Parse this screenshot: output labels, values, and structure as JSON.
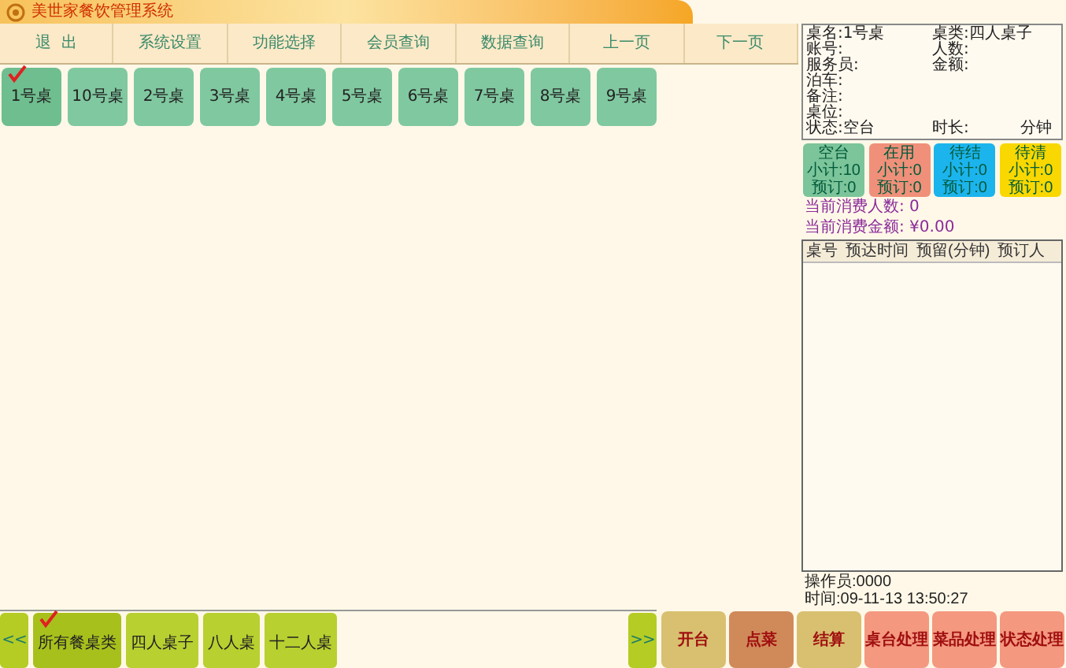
{
  "window": {
    "title": "美世家餐饮管理系统"
  },
  "menu": [
    {
      "label": "退  出"
    },
    {
      "label": "系统设置"
    },
    {
      "label": "功能选择"
    },
    {
      "label": "会员查询"
    },
    {
      "label": "数据查询"
    },
    {
      "label": "上一页"
    },
    {
      "label": "下一页"
    }
  ],
  "tables": [
    {
      "label": "1号桌",
      "selected": true
    },
    {
      "label": "10号桌",
      "selected": false
    },
    {
      "label": "2号桌",
      "selected": false
    },
    {
      "label": "3号桌",
      "selected": false
    },
    {
      "label": "4号桌",
      "selected": false
    },
    {
      "label": "5号桌",
      "selected": false
    },
    {
      "label": "6号桌",
      "selected": false
    },
    {
      "label": "7号桌",
      "selected": false
    },
    {
      "label": "8号桌",
      "selected": false
    },
    {
      "label": "9号桌",
      "selected": false
    }
  ],
  "info_rows": [
    [
      {
        "label": "桌名:",
        "value": "1号桌"
      },
      {
        "label": "桌类:",
        "value": "四人桌子"
      }
    ],
    [
      {
        "label": "账号:"
      },
      {
        "label": "人数:"
      }
    ],
    [
      {
        "label": "服务员:"
      },
      {
        "label": "金额:"
      }
    ],
    [
      {
        "label": "泊车:"
      }
    ],
    [
      {
        "label": "备注:"
      }
    ],
    [
      {
        "label": "桌位:"
      }
    ],
    [
      {
        "label": "状态:",
        "value": "空台"
      },
      {
        "label": "时长:",
        "unit": "分钟"
      }
    ]
  ],
  "status_cards": [
    {
      "name": "空台",
      "subtotal": "小计:10",
      "reserved": "预订:0",
      "color": "#7cc49a"
    },
    {
      "name": "在用",
      "subtotal": "小计:0",
      "reserved": "预订:0",
      "color": "#f0907a"
    },
    {
      "name": "待结",
      "subtotal": "小计:0",
      "reserved": "预订:0",
      "color": "#1cb4ec"
    },
    {
      "name": "待清",
      "subtotal": "小计:0",
      "reserved": "预订:0",
      "color": "#f8d800"
    }
  ],
  "summary": [
    "当前消费人数: 0",
    "当前消费金额: ¥0.00"
  ],
  "reservations": {
    "columns": [
      "桌号",
      "预达时间",
      "预留(分钟)",
      "预订人"
    ]
  },
  "status_bar": {
    "operator": "操作员:0000",
    "time": "时间:09-11-13 13:50:27"
  },
  "categories": {
    "prev": "<<",
    "next": ">>",
    "items": [
      {
        "label": "所有餐桌类",
        "selected": true
      },
      {
        "label": "四人桌子",
        "selected": false
      },
      {
        "label": "八人桌",
        "selected": false
      },
      {
        "label": "十二人桌",
        "selected": false
      }
    ]
  },
  "actions": [
    {
      "label": "开台",
      "color": "#d8c070"
    },
    {
      "label": "点菜",
      "color": "#d08a5a"
    },
    {
      "label": "结算",
      "color": "#d8c070"
    },
    {
      "label": "桌台处理",
      "color": "#f49880"
    },
    {
      "label": "菜品处理",
      "color": "#f49880"
    },
    {
      "label": "状态处理",
      "color": "#f49880"
    }
  ]
}
